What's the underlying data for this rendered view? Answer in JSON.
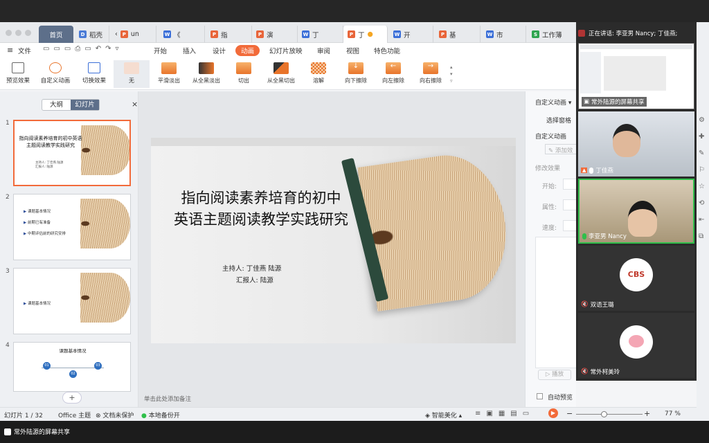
{
  "meeting": {
    "speaking": "正在讲话: 李亚男 Nancy; 丁佳燕;",
    "screen_share_tile": "常外陆源的屏幕共享",
    "participants": [
      {
        "name": "丁佳燕"
      },
      {
        "name": "李亚男 Nancy"
      },
      {
        "name": "双语王璐",
        "avatar_text": "CBS"
      },
      {
        "name": "常外柯美玲"
      }
    ],
    "bottom_share_label": "常外陆源的屏幕共享"
  },
  "tabs": [
    {
      "label": "首页",
      "type": "home"
    },
    {
      "label": "稻壳",
      "icon": "D"
    },
    {
      "label": "un",
      "icon": "P"
    },
    {
      "label": "《",
      "icon": "W"
    },
    {
      "label": "指",
      "icon": "P"
    },
    {
      "label": "演",
      "icon": "P"
    },
    {
      "label": "丁",
      "icon": "W"
    },
    {
      "label": "丁",
      "icon": "P",
      "active": true
    },
    {
      "label": "开",
      "icon": "W"
    },
    {
      "label": "基",
      "icon": "P"
    },
    {
      "label": "市",
      "icon": "W"
    },
    {
      "label": "工作薄",
      "icon": "S"
    }
  ],
  "menu": {
    "file": "文件",
    "items": [
      "开始",
      "插入",
      "设计",
      "动画",
      "幻灯片放映",
      "审阅",
      "视图",
      "特色功能"
    ],
    "active": "动画"
  },
  "ribbon": {
    "preview": "预览效果",
    "custom": "自定义动画",
    "switch": "切换效果",
    "effects": [
      "无",
      "平滑淡出",
      "从全黑淡出",
      "切出",
      "从全黑切出",
      "溶解",
      "向下擦除",
      "向左擦除",
      "向右擦除"
    ]
  },
  "left_panel": {
    "tab_outline": "大纲",
    "tab_slides": "幻灯片",
    "slides": [
      {
        "num": "1",
        "title": "指向阅读素养培育的初中英语主题阅读教学实践研究",
        "sub1": "主持人: 丁佳燕 陆源",
        "sub2": "汇报人: 陆源"
      },
      {
        "num": "2",
        "bullets": [
          "课题基本情况",
          "前期已有准备",
          "中期评估前的研究安排"
        ]
      },
      {
        "num": "3",
        "bullets": [
          "课题基本情况"
        ]
      },
      {
        "num": "4",
        "title": "课题基本情况",
        "nodes": [
          "01",
          "02",
          "03"
        ]
      }
    ],
    "add": "+"
  },
  "slide": {
    "title_line1": "指向阅读素养培育的初中",
    "title_line2": "英语主题阅读教学实践研究",
    "host": "主持人: 丁佳燕 陆源",
    "reporter": "汇报人: 陆源"
  },
  "notes_placeholder": "单击此处添加备注",
  "right_panel": {
    "header": "自定义动画",
    "select_pane": "选择窗格",
    "custom_anim": "自定义动画",
    "add_effect": "添加效",
    "modify": "修改效果",
    "start": "开始:",
    "property": "属性:",
    "speed": "速度:",
    "play": "播放",
    "auto_preview": "自动预览"
  },
  "status": {
    "slide_count": "幻灯片 1 / 32",
    "theme": "Office 主题",
    "doc_protect": "文档未保护",
    "backup": "本地备份开",
    "beautify": "智能美化",
    "zoom": "77 %",
    "zoom_level": 0.77
  },
  "colors": {
    "accent": "#f26b3a",
    "wps_blue": "#3b6fd8",
    "meet_green": "#2fbf4a"
  }
}
